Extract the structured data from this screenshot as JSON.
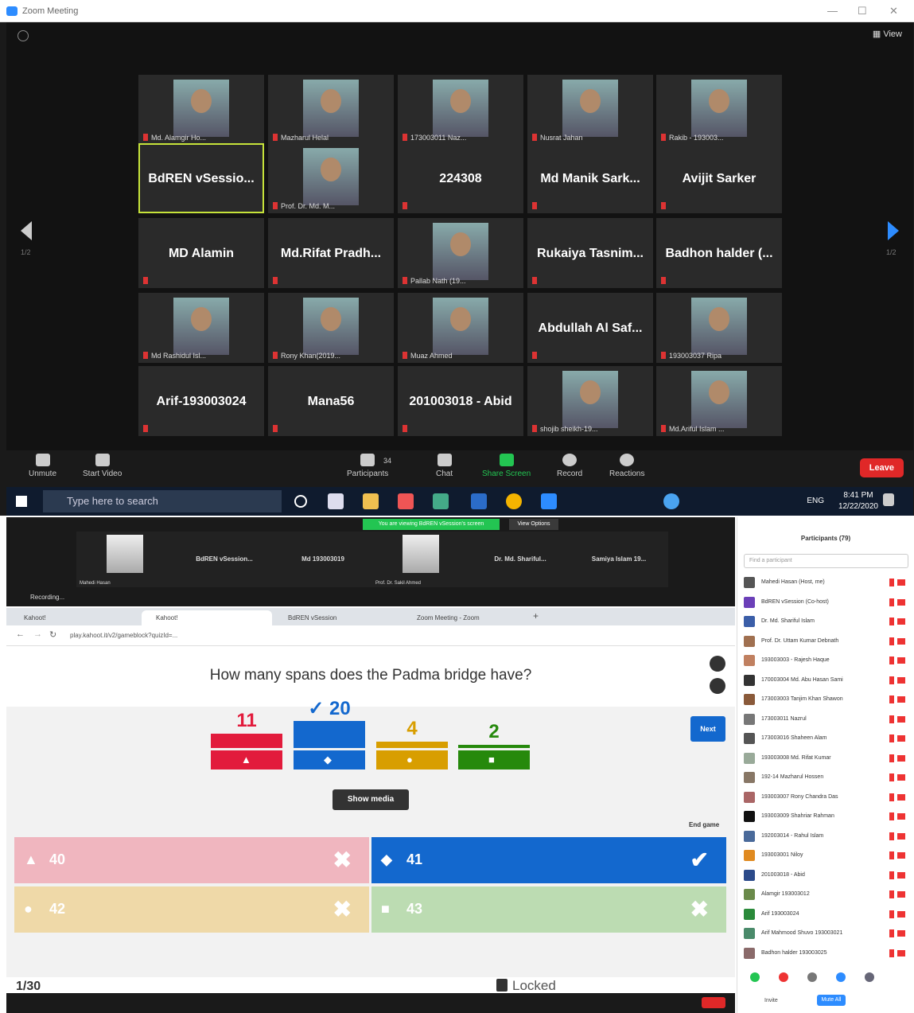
{
  "top": {
    "title": "Zoom Meeting",
    "view_label": "View",
    "page_left": "1/2",
    "page_right": "1/2",
    "tiles": [
      {
        "label": "Md. Alamgir Ho...",
        "photo": true
      },
      {
        "label": "Mazharul Helal",
        "photo": true
      },
      {
        "label": "173003011 Naz...",
        "photo": true
      },
      {
        "label": "Nusrat Jahan",
        "photo": true
      },
      {
        "label": "Rakib - 193003...",
        "photo": true
      },
      {
        "name": "BdREN vSessio...",
        "active": true
      },
      {
        "label": "Prof. Dr. Md. M...",
        "photo": true
      },
      {
        "name": "224308"
      },
      {
        "name": "Md Manik Sark..."
      },
      {
        "name": "Avijit Sarker"
      },
      {
        "name": "MD Alamin"
      },
      {
        "name": "Md.Rifat Pradh..."
      },
      {
        "label": "Pallab Nath (19...",
        "photo": true
      },
      {
        "name": "Rukaiya Tasnim..."
      },
      {
        "name": "Badhon halder (..."
      },
      {
        "label": "Md Rashidul Isl...",
        "photo": true
      },
      {
        "label": "Rony Khan(2019...",
        "photo": true
      },
      {
        "label": "Muaz Ahmed",
        "photo": true
      },
      {
        "name": "Abdullah Al Saf..."
      },
      {
        "label": "193003037 Ripa",
        "photo": true
      },
      {
        "name": "Arif-193003024"
      },
      {
        "name": "Mana56"
      },
      {
        "name": "201003018 - Abid"
      },
      {
        "label": "shojib sheikh-19...",
        "photo": true
      },
      {
        "label": "Md.Ariful Islam ...",
        "photo": true
      }
    ],
    "toolbar": {
      "unmute": "Unmute",
      "start_video": "Start Video",
      "participants": "Participants",
      "participants_count": "34",
      "chat": "Chat",
      "share_screen": "Share Screen",
      "record": "Record",
      "reactions": "Reactions",
      "leave": "Leave"
    },
    "taskbar": {
      "search_placeholder": "Type here to search",
      "lang": "ENG",
      "time": "8:41 PM",
      "date": "12/22/2020"
    }
  },
  "bottom": {
    "share_banner": "You are viewing BdREN vSession's screen",
    "view_options": "View Options",
    "strip": [
      {
        "name": "Mahedi Hasan",
        "photo": true
      },
      {
        "name": "BdREN vSession..."
      },
      {
        "name": "Md 193003019"
      },
      {
        "name": "Prof. Dr. Sakil Ahmed",
        "photo": true
      },
      {
        "name": "Dr. Md. Shariful..."
      },
      {
        "name": "Samiya Islam 19..."
      }
    ],
    "recording": "Recording...",
    "browser_tabs": [
      "Kahoot!",
      "Kahoot!",
      "BdREN vSession",
      "Zoom Meeting - Zoom"
    ],
    "url": "play.kahoot.it/v2/gameblock?quizId=...",
    "question": "How many spans does the Padma bridge have?",
    "next_label": "Next",
    "results": [
      {
        "value": "11",
        "color": "#e21b3c",
        "shape": "▲"
      },
      {
        "value": "✓ 20",
        "color": "#1368ce",
        "shape": "◆"
      },
      {
        "value": "4",
        "color": "#d89e00",
        "shape": "●"
      },
      {
        "value": "2",
        "color": "#26890c",
        "shape": "■"
      }
    ],
    "show_media": "Show media",
    "end_game": "End game",
    "answers": [
      {
        "shape": "▲",
        "text": "40",
        "color": "#f0b6bf",
        "mark": "✖"
      },
      {
        "shape": "◆",
        "text": "41",
        "color": "#1368ce",
        "mark": "✔"
      },
      {
        "shape": "●",
        "text": "42",
        "color": "#efd9a8",
        "mark": "✖"
      },
      {
        "shape": "■",
        "text": "43",
        "color": "#bcdcb2",
        "mark": "✖"
      }
    ],
    "question_count": "1/30",
    "locked": "Locked",
    "panel": {
      "title": "Participants (79)",
      "find_placeholder": "Find a participant",
      "participants": [
        "Mahedi Hasan (Host, me)",
        "BdREN vSession (Co-host)",
        "Dr. Md. Shariful Islam",
        "Prof. Dr. Uttam Kumar Debnath",
        "193003003 - Rajesh Haque",
        "170003004 Md. Abu Hasan Sami",
        "173003003 Tanjim Khan Shawon",
        "173003011 Nazrul",
        "173003016 Shaheen Alam",
        "193003008 Md. Rifat Kumar",
        "192-14 Mazharul Hossen",
        "193003007 Rony Chandra Das",
        "193003009 Shahriar Rahman",
        "192003014 - Rahul Islam",
        "193003001 Niloy",
        "201003018 - Abid",
        "Alamgir 193003012",
        "Arif 193003024",
        "Arif Mahmood Shuvo 193003021",
        "Badhon halder 193003025"
      ],
      "invite": "Invite",
      "mute_all": "Mute All"
    }
  }
}
